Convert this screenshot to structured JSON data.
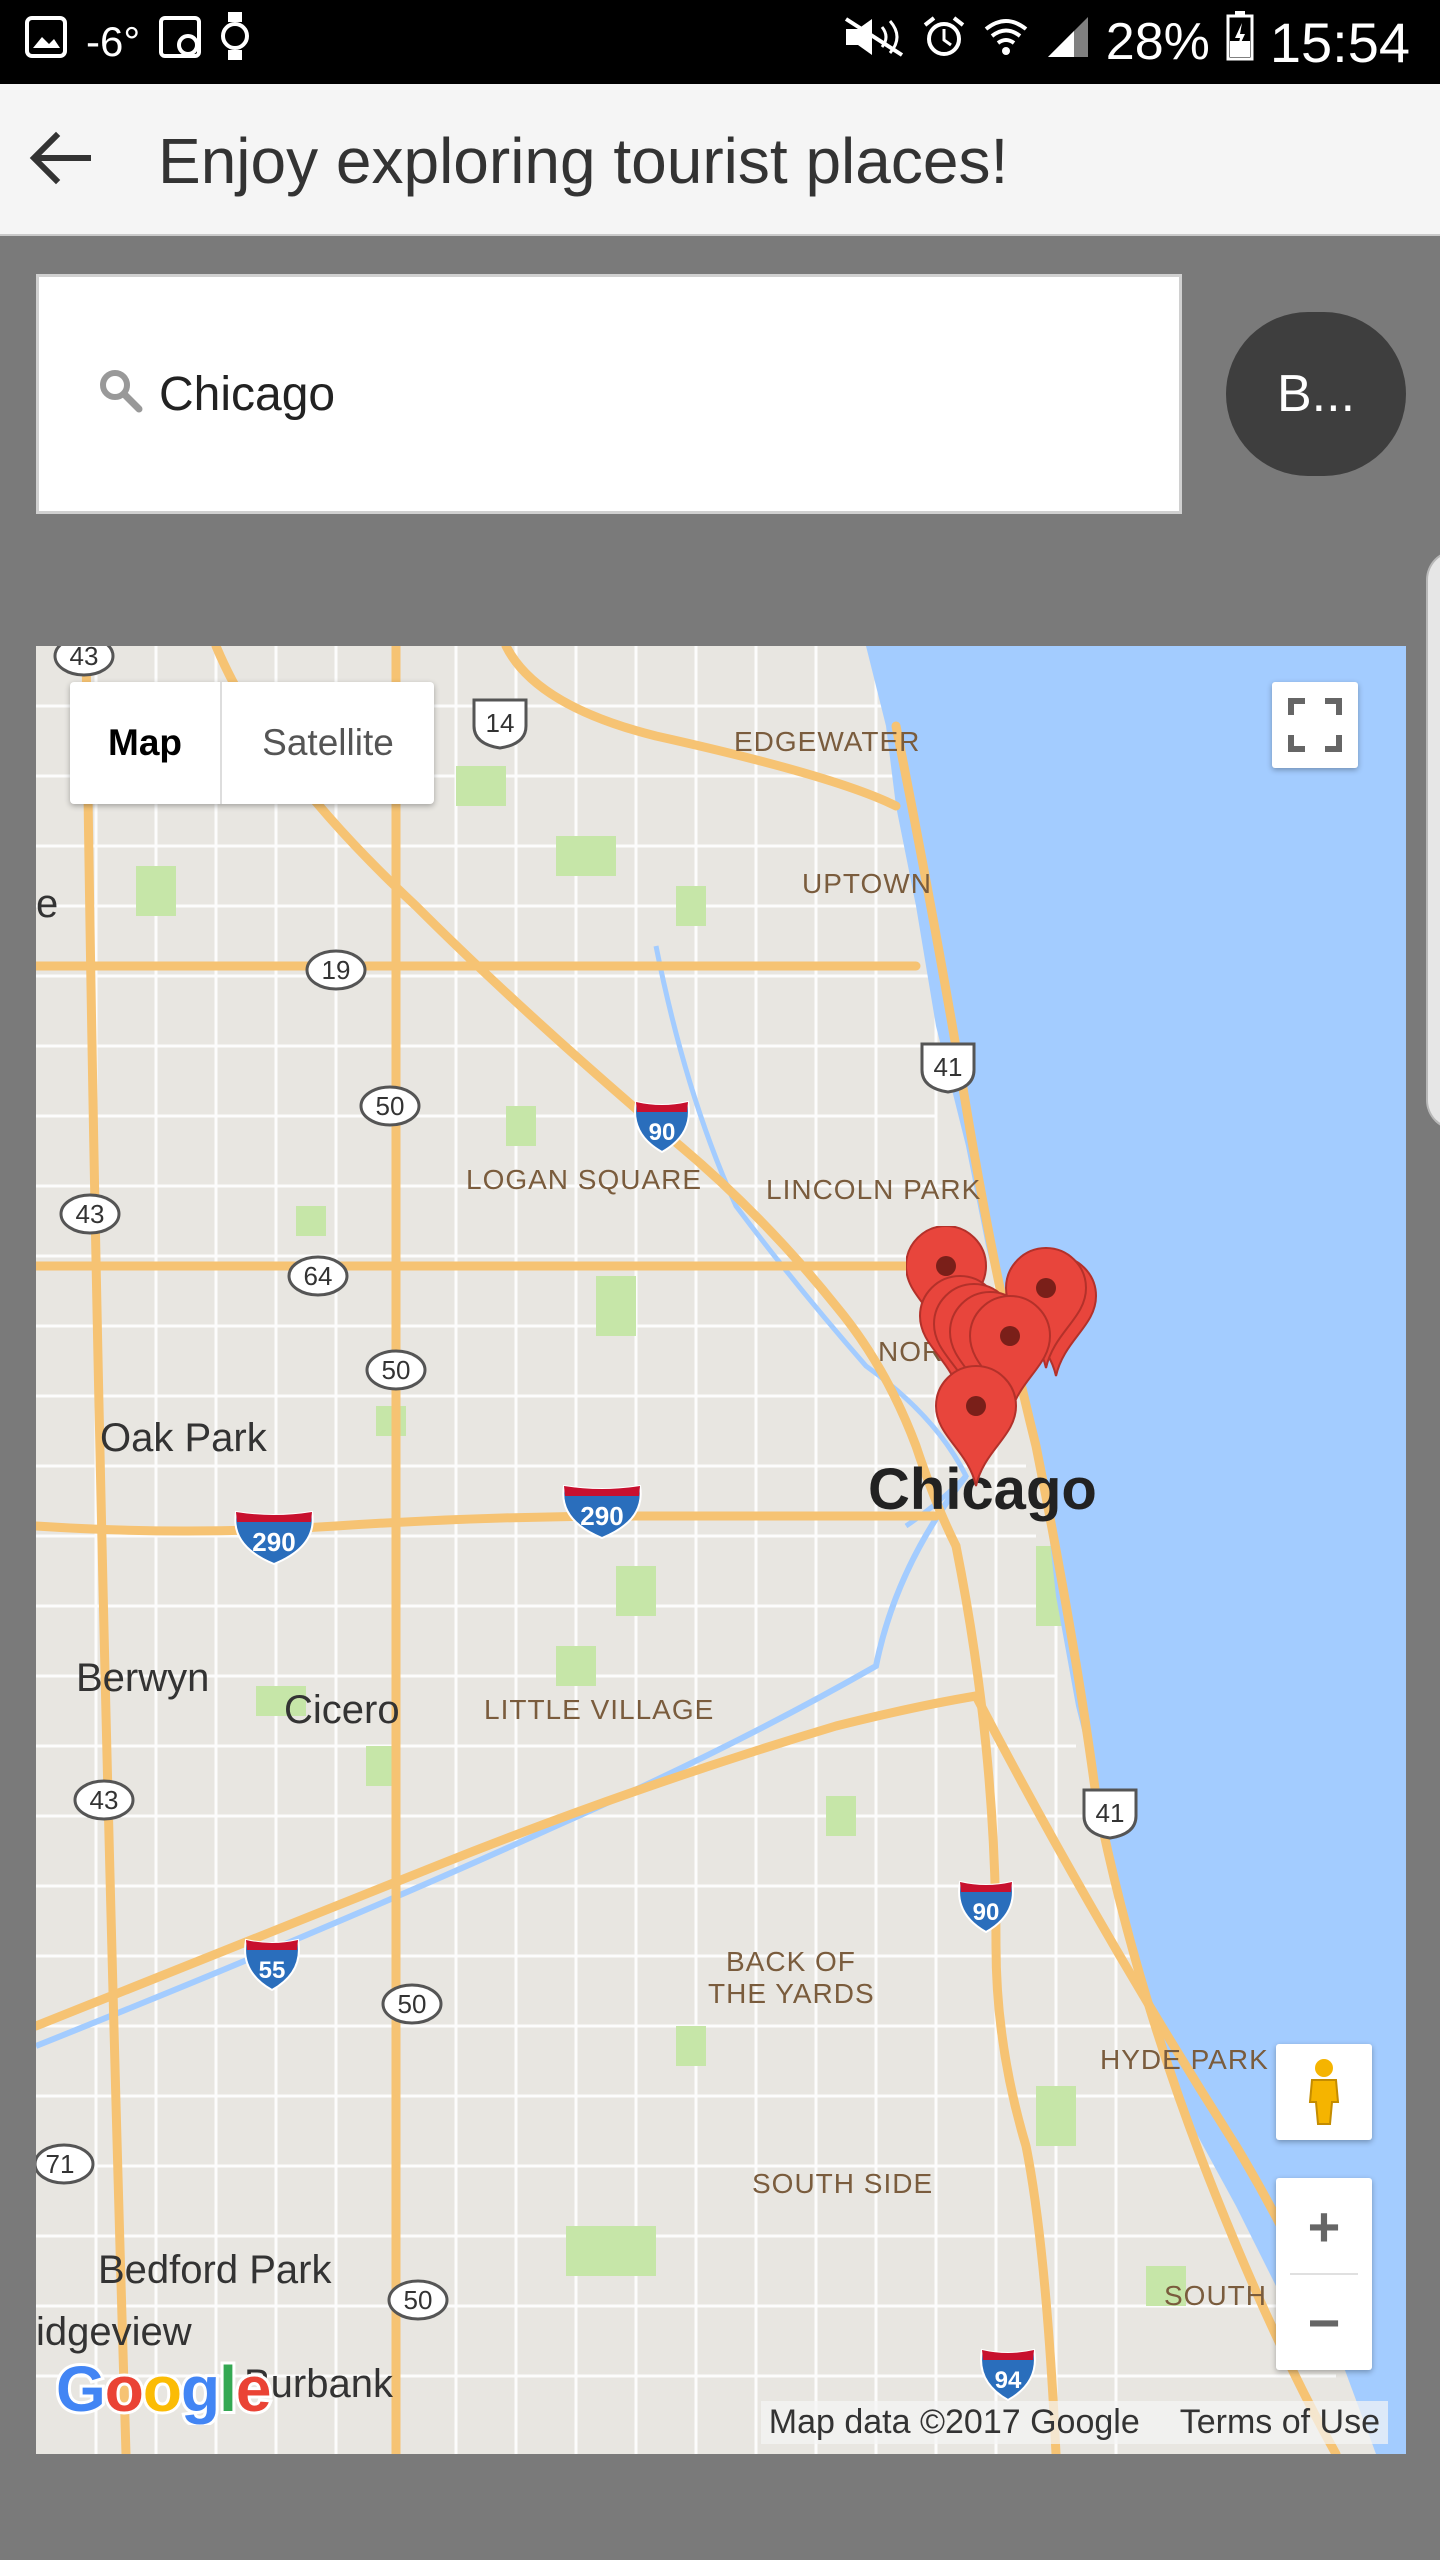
{
  "status_bar": {
    "temperature": "-6°",
    "battery": "28%",
    "time": "15:54"
  },
  "app_bar": {
    "title": "Enjoy exploring tourist places!"
  },
  "search": {
    "value": "Chicago"
  },
  "action_button": {
    "label": "B..."
  },
  "map": {
    "type_map_label": "Map",
    "type_satellite_label": "Satellite",
    "zoom_in_label": "+",
    "zoom_out_label": "−",
    "attribution": "Map data ©2017 Google",
    "terms": "Terms of Use",
    "logo": "Google",
    "places": {
      "edgewater": "EDGEWATER",
      "uptown": "UPTOWN",
      "logan_square": "LOGAN SQUARE",
      "lincoln_park": "LINCOLN PARK",
      "north": "NOR",
      "oak_park": "Oak Park",
      "chicago": "Chicago",
      "berwyn": "Berwyn",
      "cicero": "Cicero",
      "little_village": "LITTLE VILLAGE",
      "back_of_the_yards_1": "BACK OF",
      "back_of_the_yards_2": "THE YARDS",
      "hyde_park": "HYDE PARK",
      "south_side": "SOUTH SIDE",
      "bedford_park": "Bedford Park",
      "south": "SOUTH",
      "bridgeview": "idgeview",
      "burbank": "Burbank",
      "edge_e": "e"
    },
    "shields": {
      "us14": "14",
      "r19": "19",
      "r50a": "50",
      "r50b": "50",
      "r50c": "50",
      "r50d": "50",
      "r43a": "43",
      "r43b": "43",
      "r43c": "43",
      "r64": "64",
      "us41a": "41",
      "us41b": "41",
      "i90a": "90",
      "i90b": "90",
      "i290a": "290",
      "i290b": "290",
      "i55": "55",
      "i94": "94",
      "r171": "71"
    },
    "marker_color": "#e8453c",
    "water_color": "#a3ccff"
  }
}
